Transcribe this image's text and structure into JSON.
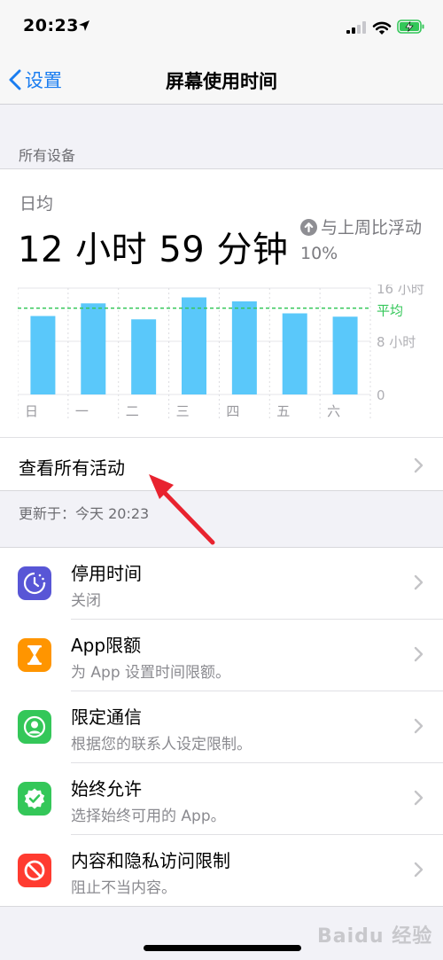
{
  "status": {
    "time": "20:23"
  },
  "nav": {
    "back_label": "设置",
    "title": "屏幕使用时间"
  },
  "section_header": "所有设备",
  "summary": {
    "daily_label": "日均",
    "daily_value": "12 小时 59 分钟",
    "compare_text": "与上周比浮动10%"
  },
  "chart_data": {
    "type": "bar",
    "categories": [
      "日",
      "一",
      "二",
      "三",
      "四",
      "五",
      "六"
    ],
    "values": [
      11.8,
      13.7,
      11.3,
      14.6,
      14.0,
      12.2,
      11.7
    ],
    "average": 12.98,
    "ylim": [
      0,
      16
    ],
    "yticks": [
      "16 小时",
      "8 小时",
      "0"
    ],
    "average_label": "平均",
    "bar_color": "#5ac8fa",
    "average_color": "#34c759"
  },
  "view_all_label": "查看所有活动",
  "updated_text": "更新于：今天 20:23",
  "menu": [
    {
      "title": "停用时间",
      "subtitle": "关闭",
      "icon": "downtime-icon",
      "color": "#5856d6"
    },
    {
      "title": "App限额",
      "subtitle": "为 App 设置时间限额。",
      "icon": "hourglass-icon",
      "color": "#ff9500"
    },
    {
      "title": "限定通信",
      "subtitle": "根据您的联系人设定限制。",
      "icon": "contact-icon",
      "color": "#34c759"
    },
    {
      "title": "始终允许",
      "subtitle": "选择始终可用的 App。",
      "icon": "check-badge-icon",
      "color": "#34c759"
    },
    {
      "title": "内容和隐私访问限制",
      "subtitle": "阻止不当内容。",
      "icon": "block-icon",
      "color": "#ff3b30"
    }
  ]
}
